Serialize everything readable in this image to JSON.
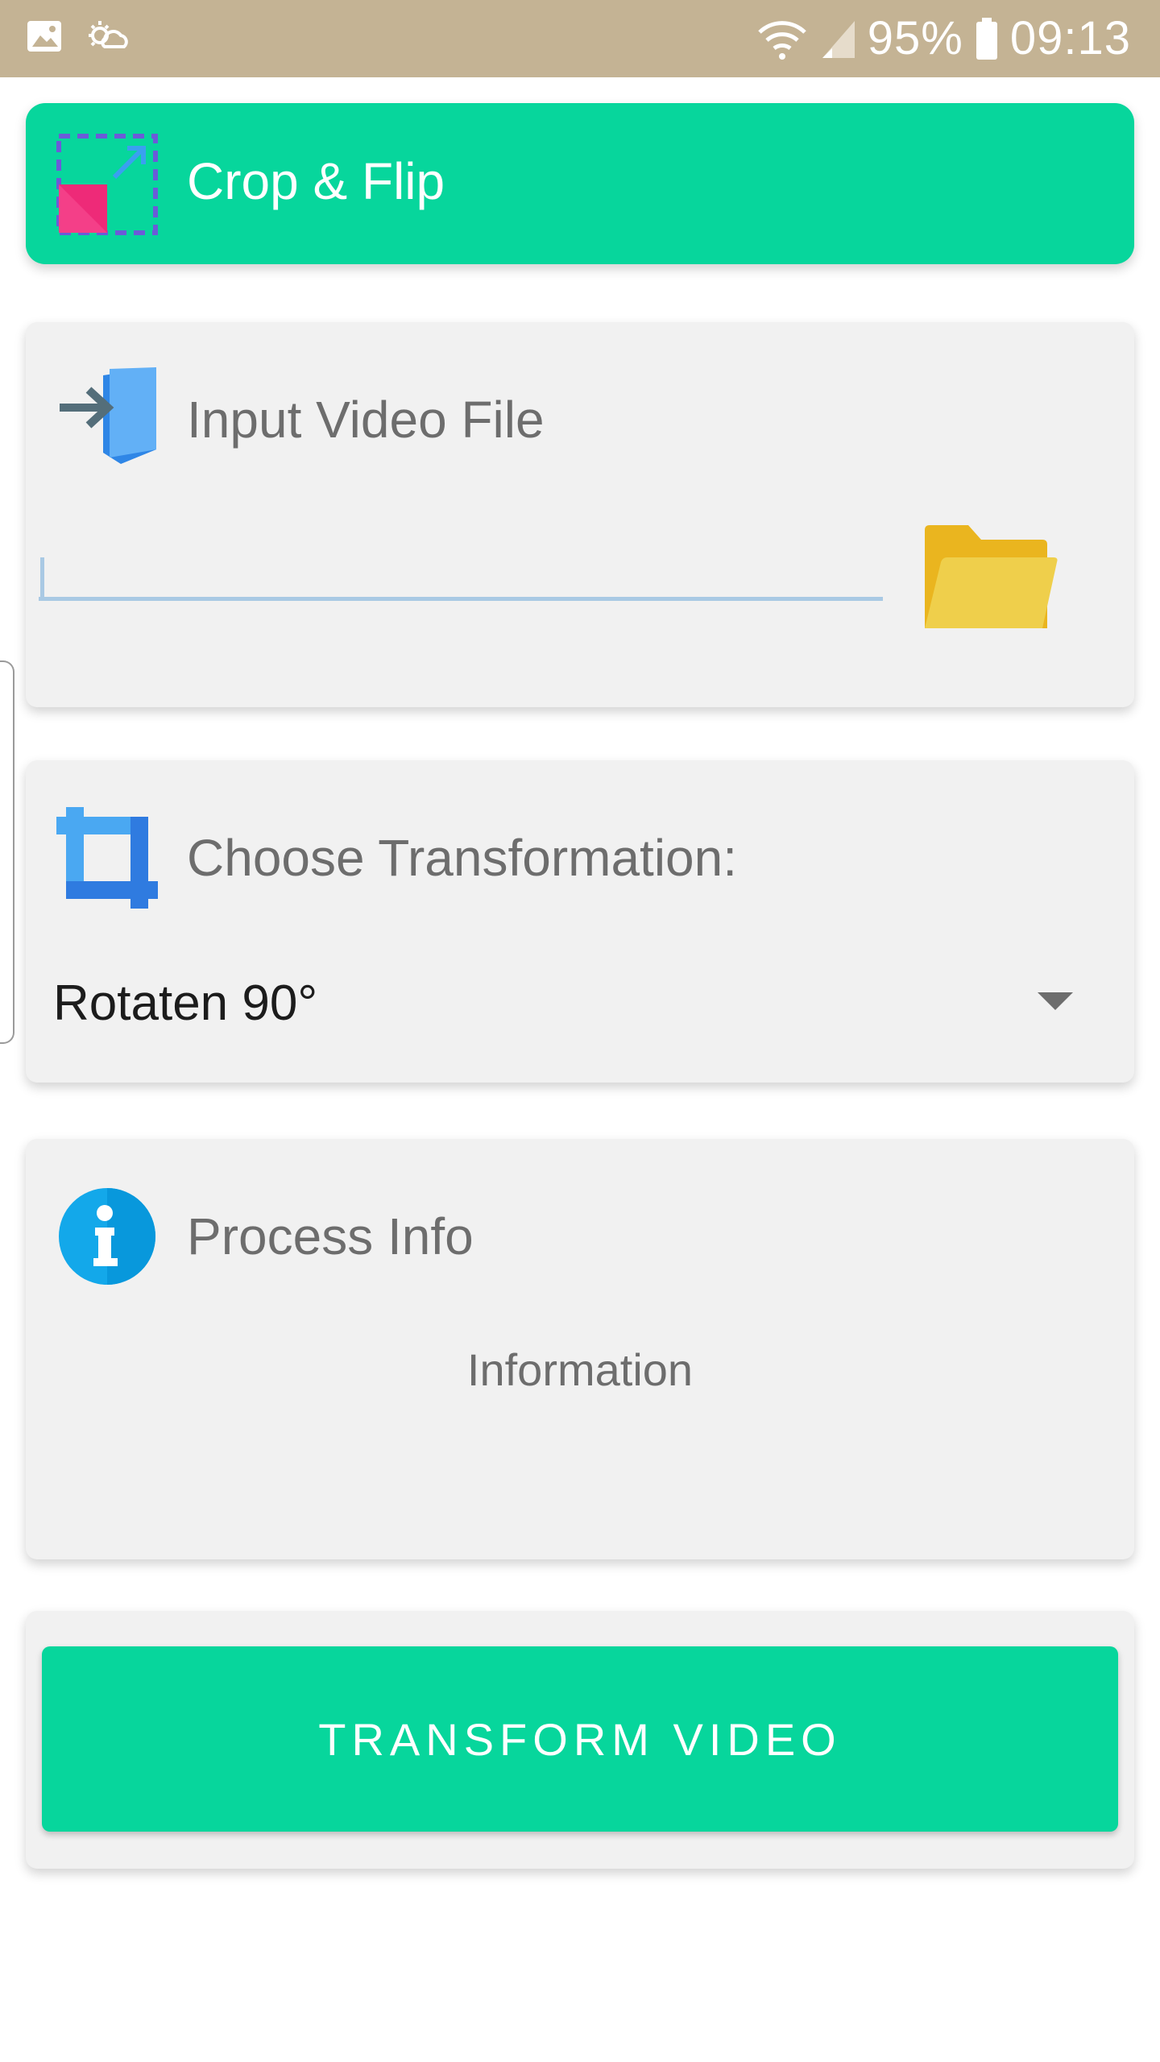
{
  "status_bar": {
    "icons": [
      "gallery-icon",
      "weather-icon",
      "wifi-icon",
      "signal-icon",
      "battery-icon"
    ],
    "battery": "95%",
    "time": "09:13"
  },
  "header": {
    "title": "Crop & Flip",
    "icon": "crop-resize-icon"
  },
  "input_card": {
    "title": "Input Video File",
    "icon": "input-file-icon",
    "field_value": "",
    "browse_icon": "folder-icon"
  },
  "transform_card": {
    "title": "Choose Transformation:",
    "icon": "crop-icon",
    "selected": "Rotaten 90°"
  },
  "info_card": {
    "title": "Process Info",
    "icon": "info-icon",
    "text": "Information"
  },
  "action": {
    "button_label": "TRANSFORM VIDEO"
  },
  "colors": {
    "accent": "#07d69c",
    "status_bar": "#c4b394",
    "card": "#f1f1f1"
  }
}
